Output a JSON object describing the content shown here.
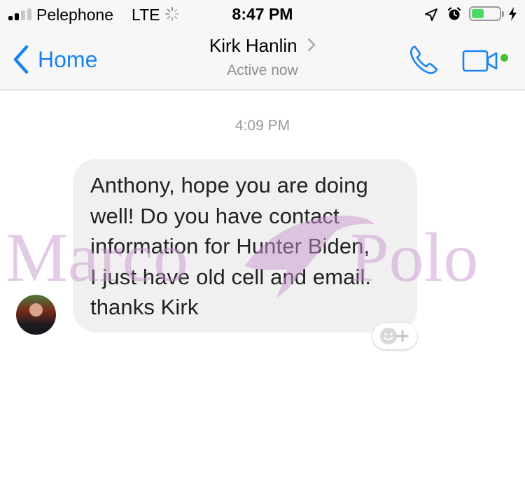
{
  "status_bar": {
    "carrier": "Pelephone",
    "network": "LTE",
    "time": "8:47 PM",
    "battery_level": 0.45,
    "icons": [
      "signal-bars-icon",
      "loading-spinner-icon",
      "location-arrow-icon",
      "alarm-clock-icon",
      "battery-icon",
      "charging-bolt-icon"
    ]
  },
  "header": {
    "back_label": "Home",
    "contact_name": "Kirk Hanlin",
    "presence": "Active now",
    "icons": [
      "chevron-left-icon",
      "chevron-right-icon",
      "phone-icon",
      "video-camera-icon"
    ],
    "accent_color": "#1a82f5",
    "online_color": "#44c136"
  },
  "conversation": {
    "timestamp": "4:09 PM",
    "message": {
      "lines": [
        "Anthony, hope you are doing",
        "well! Do you have contact",
        "information for Hunter Biden,",
        "I just have old cell and email.",
        "thanks Kirk"
      ]
    },
    "react_icon": "emoji-add-icon"
  },
  "watermark": {
    "left_text": "Marco",
    "right_text": "Polo",
    "color": "#c896cd"
  }
}
